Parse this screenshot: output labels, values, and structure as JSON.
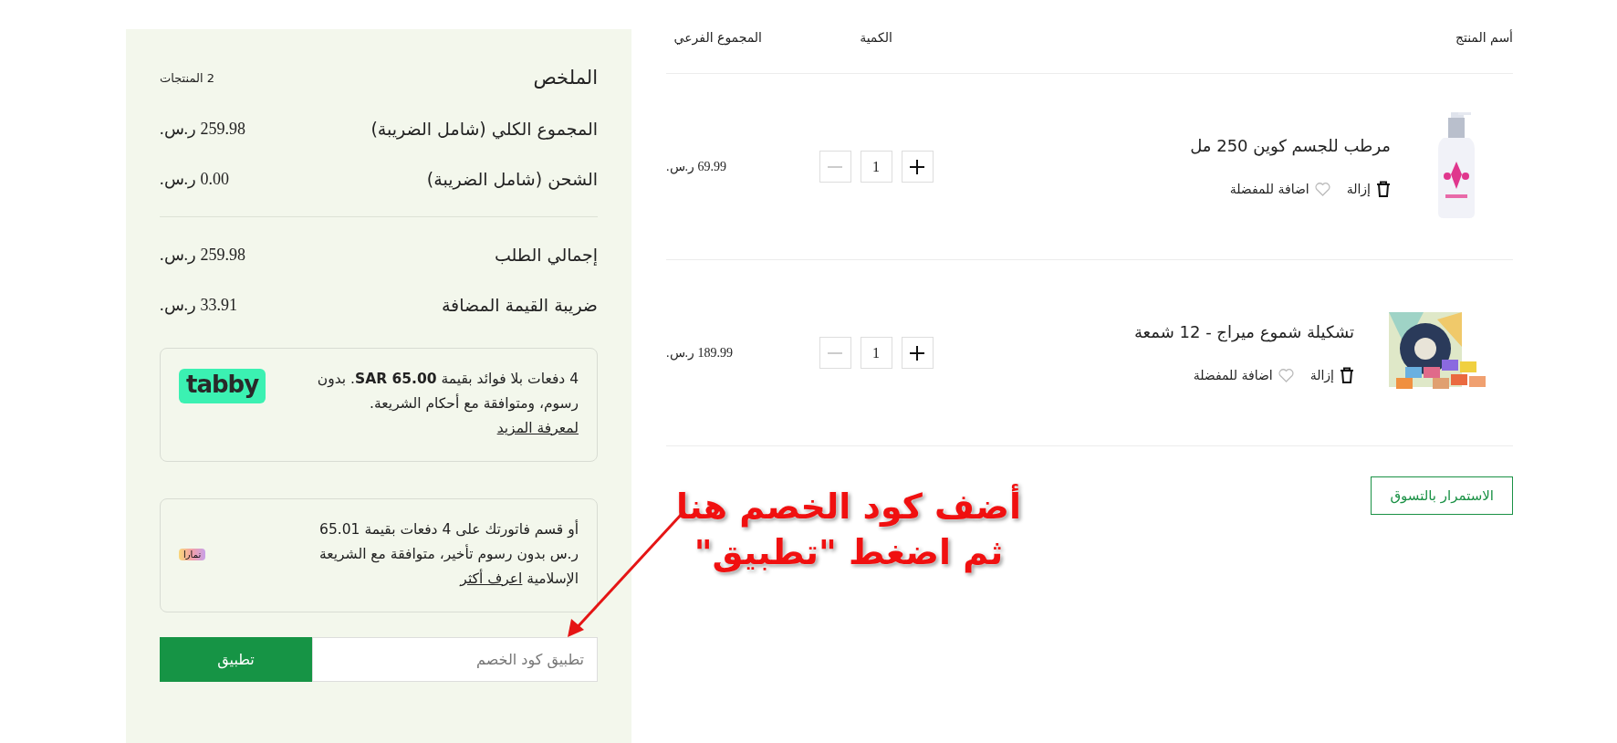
{
  "cart": {
    "columns": [
      "أسم المنتج",
      "الكمية",
      "المجموع الفرعي"
    ],
    "items": [
      {
        "name": "مرطب للجسم كوين 250 مل",
        "remove": "إزالة",
        "favorite": "اضافة للمفضلة",
        "quantity": "1",
        "minus_disabled": true,
        "subtotal": "69.99 ر.س."
      },
      {
        "name": "تشكيلة شموع ميراج - 12 شمعة",
        "remove": "إزالة",
        "favorite": "اضافة للمفضلة",
        "quantity": "1",
        "minus_disabled": true,
        "subtotal": "189.99 ر.س."
      }
    ],
    "continue_button": "الاستمرار بالتسوق"
  },
  "summary": {
    "title": "الملخص",
    "count": "2 المنتجات",
    "groups": [
      [
        {
          "label": "المجموع الكلي (شامل الضريبة)",
          "value": "259.98 ر.س."
        },
        {
          "label": "الشحن (شامل الضريبة)",
          "value": "0.00 ر.س."
        }
      ],
      [
        {
          "label": "إجمالي الطلب",
          "value": "259.98 ر.س."
        },
        {
          "label": "ضريبة القيمة المضافة",
          "value": "33.91 ر.س."
        }
      ]
    ],
    "offers": [
      {
        "kind": "tabby",
        "text": "4 دفعات بلا فوائد بقيمة **SAR 65.00**. بدون رسوم، ومتوافقة مع أحكام الشريعة.",
        "link": "لمعرفة المزيد",
        "logo": "tabby"
      },
      {
        "kind": "tamara",
        "text": "أو قسم فاتورتك على 4 دفعات بقيمة 65.01 ر.س بدون رسوم تأخير، متوافقة مع الشريعة الإسلامية",
        "link": "اعرف أكثر",
        "logo": "تمارا"
      }
    ],
    "coupon": {
      "placeholder": "تطبيق كود الخصم",
      "button": "تطبيق"
    }
  },
  "annotation": {
    "lines": [
      "أضف كود الخصم هنا",
      "ثم اضغط \"تطبيق\""
    ]
  }
}
